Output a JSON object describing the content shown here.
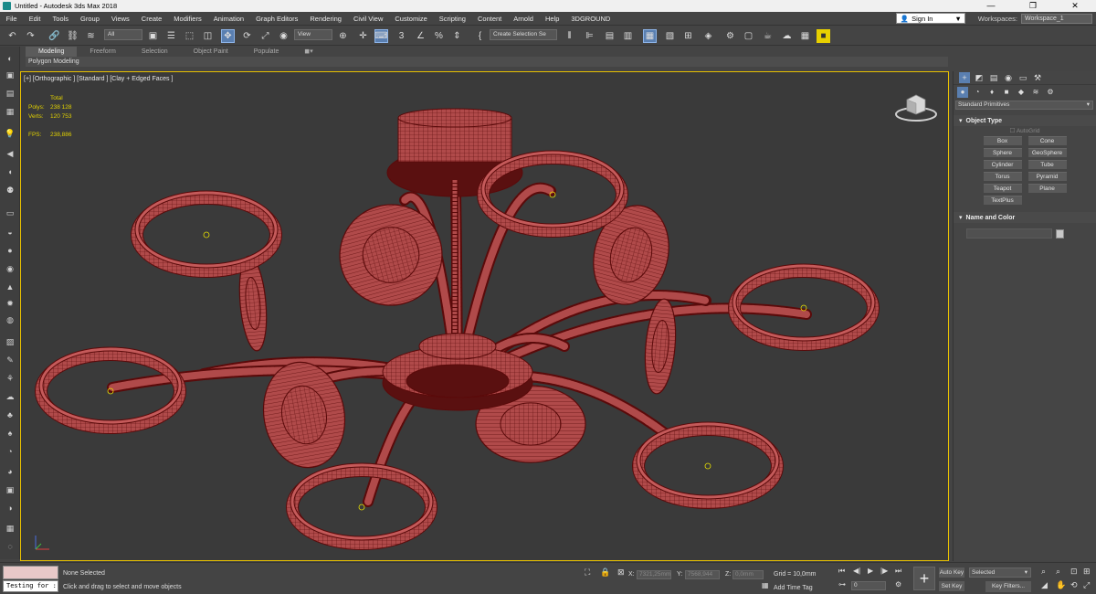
{
  "window": {
    "title": "Untitled - Autodesk 3ds Max 2018",
    "minimize": "—",
    "maximize": "❐",
    "close": "✕"
  },
  "menu": [
    "File",
    "Edit",
    "Tools",
    "Group",
    "Views",
    "Create",
    "Modifiers",
    "Animation",
    "Graph Editors",
    "Rendering",
    "Civil View",
    "Customize",
    "Scripting",
    "Content",
    "Arnold",
    "Help",
    "3DGROUND"
  ],
  "account": {
    "sign_in": "Sign In",
    "workspaces_label": "Workspaces:",
    "workspace": "Workspace_1"
  },
  "toolbar": {
    "filter": "All",
    "view": "View",
    "selection_set": "Create Selection Se"
  },
  "ribbon": {
    "tabs": [
      "Modeling",
      "Freeform",
      "Selection",
      "Object Paint",
      "Populate"
    ],
    "active": "Modeling",
    "sub": "Polygon Modeling"
  },
  "viewport": {
    "label": "[+] [Orthographic ] [Standard ] [Clay + Edged Faces ]",
    "stats": {
      "total_label": "Total",
      "polys_label": "Polys:",
      "polys": "238 128",
      "verts_label": "Verts:",
      "verts": "120 753",
      "fps_label": "FPS:",
      "fps": "238,886"
    },
    "mesh_color": "#b04a4a",
    "wire_color": "#5a0a0a"
  },
  "command_panel": {
    "dropdown": "Standard Primitives",
    "object_type": {
      "title": "Object Type",
      "autogrid": "AutoGrid",
      "buttons": [
        "Box",
        "Cone",
        "Sphere",
        "GeoSphere",
        "Cylinder",
        "Tube",
        "Torus",
        "Pyramid",
        "Teapot",
        "Plane",
        "TextPlus"
      ]
    },
    "name_color": {
      "title": "Name and Color"
    }
  },
  "status": {
    "maxscript": "Testing for :",
    "selection": "None Selected",
    "prompt": "Click and drag to select and move objects",
    "x_label": "X:",
    "x": "7321,25mm",
    "y_label": "Y:",
    "y": "7568,944",
    "z_label": "Z:",
    "z": "0,0mm",
    "grid": "Grid = 10,0mm",
    "add_time_tag": "Add Time Tag",
    "frame": "0",
    "auto_key": "Auto Key",
    "set_key": "Set Key",
    "selected": "Selected",
    "key_filters": "Key Filters..."
  }
}
